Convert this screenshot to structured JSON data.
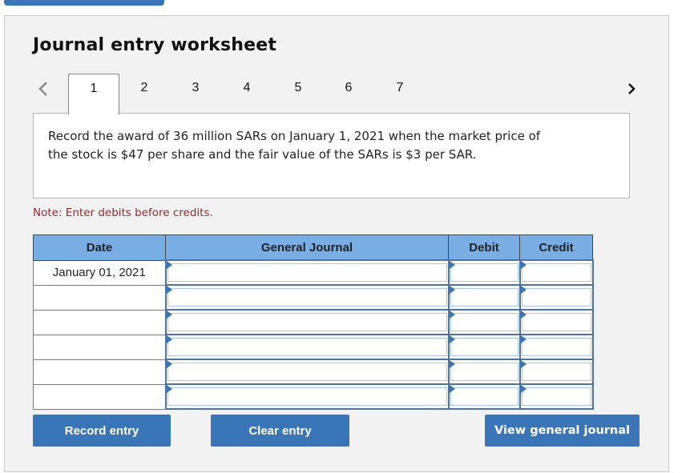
{
  "header": {
    "title": "Journal entry worksheet"
  },
  "navigation": {
    "prev_icon": "chevron-left-icon",
    "next_icon": "chevron-right-icon",
    "active_tab": "1",
    "tabs": [
      {
        "label": "1"
      },
      {
        "label": "2"
      },
      {
        "label": "3"
      },
      {
        "label": "4"
      },
      {
        "label": "5"
      },
      {
        "label": "6"
      },
      {
        "label": "7"
      }
    ]
  },
  "prompt": {
    "text": "Record the award of 36 million SARs on January 1, 2021 when the market price of the stock is $47 per share and the fair value of the SARs is $3 per SAR."
  },
  "note": "Note: Enter debits before credits.",
  "table": {
    "headers": {
      "date": "Date",
      "general_journal": "General Journal",
      "debit": "Debit",
      "credit": "Credit"
    },
    "rows": [
      {
        "date": "January 01, 2021",
        "account": "",
        "debit": "",
        "credit": ""
      },
      {
        "date": "",
        "account": "",
        "debit": "",
        "credit": ""
      },
      {
        "date": "",
        "account": "",
        "debit": "",
        "credit": ""
      },
      {
        "date": "",
        "account": "",
        "debit": "",
        "credit": ""
      },
      {
        "date": "",
        "account": "",
        "debit": "",
        "credit": ""
      },
      {
        "date": "",
        "account": "",
        "debit": "",
        "credit": ""
      }
    ]
  },
  "buttons": {
    "record": "Record entry",
    "clear": "Clear entry",
    "view": "View general journal"
  },
  "colors": {
    "accent": "#3a75b8",
    "table_header": "#78aee4",
    "note_text": "#a0262a",
    "panel_background": "#f2f2f2"
  }
}
